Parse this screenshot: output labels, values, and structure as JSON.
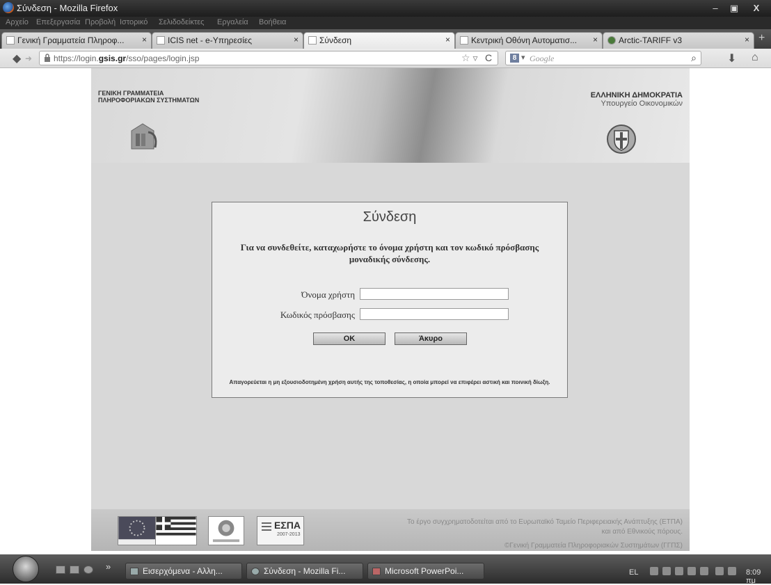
{
  "window": {
    "title": "Σύνδεση - Mozilla Firefox",
    "controls": {
      "minimize": "–",
      "maximize": "▣",
      "close": "X"
    }
  },
  "menubar": {
    "items": [
      "Αρχείο",
      "Επεξεργασία",
      "Προβολή",
      "Ιστορικό",
      "Σελιδοδείκτες",
      "Εργαλεία",
      "Βοήθεια"
    ]
  },
  "tabs": [
    {
      "label": "Γενική Γραμματεία Πληροφ...",
      "active": false
    },
    {
      "label": "ICIS net - e-Υπηρεσίες",
      "active": false
    },
    {
      "label": "Σύνδεση",
      "active": true
    },
    {
      "label": "Κεντρική Οθόνη Αυτοματισ...",
      "active": false
    },
    {
      "label": "Arctic-TARIFF v3",
      "active": false
    }
  ],
  "tab_close": "×",
  "new_tab": "+",
  "nav": {
    "back": "◆",
    "forward": "➜",
    "url_prefix": "https://login.",
    "url_domain": "gsis.gr",
    "url_suffix": "/sso/pages/login.jsp",
    "bookmark_star": "☆ ▿",
    "reload": "C",
    "search_engine_letter": "8",
    "search_dropdown": "▾",
    "search_placeholder": "Google",
    "search_button": "⌕",
    "downloads": "⬇",
    "home": "⌂"
  },
  "header": {
    "org_left_line1": "ΓΕΝΙΚΗ ΓΡΑΜΜΑΤΕΙΑ",
    "org_left_line2": "ΠΛΗΡΟΦΟΡΙΑΚΩΝ ΣΥΣΤΗΜΑΤΩΝ",
    "org_right_line1": "ΕΛΛΗΝΙΚΗ ΔΗΜΟΚΡΑΤΙΑ",
    "org_right_line2": "Υπουργείο Οικονομικών"
  },
  "login": {
    "title": "Σύνδεση",
    "description": "Για να συνδεθείτε, καταχωρήστε το όνομα χρήστη και τον κωδικό πρόσβασης μοναδικής σύνδεσης.",
    "username_label": "Όνομα χρήστη",
    "username_value": "",
    "password_label": "Κωδικός πρόσβασης",
    "password_value": "",
    "ok_button": "OK",
    "cancel_button": "Άκυρο",
    "warning": "Απαγορεύεται η μη εξουσιοδοτημένη χρήση αυτής της τοποθεσίας, η οποία μπορεί να επιφέρει αστική και ποινική δίωξη."
  },
  "footer": {
    "espa_logo_text": "ΕΣΠΑ",
    "espa_years": "2007-2013",
    "text_line1": "Το έργο συγχρηματοδοτείται από το Ευρωπαϊκό Ταμείο Περιφερειακής Ανάπτυξης (ΕΤΠΑ)",
    "text_line2": "και από Εθνικούς πόρους.",
    "text_line3": "©Γενική Γραμματεία Πληροφοριακών Συστημάτων (ΓΓΠΣ)"
  },
  "taskbar": {
    "chevron": "»",
    "tasks": [
      {
        "label": "Εισερχόμενα - Αλλη..."
      },
      {
        "label": "Σύνδεση - Mozilla Fi..."
      },
      {
        "label": "Microsoft PowerPoi..."
      }
    ],
    "language": "EL",
    "clock": "8:09 πμ"
  }
}
